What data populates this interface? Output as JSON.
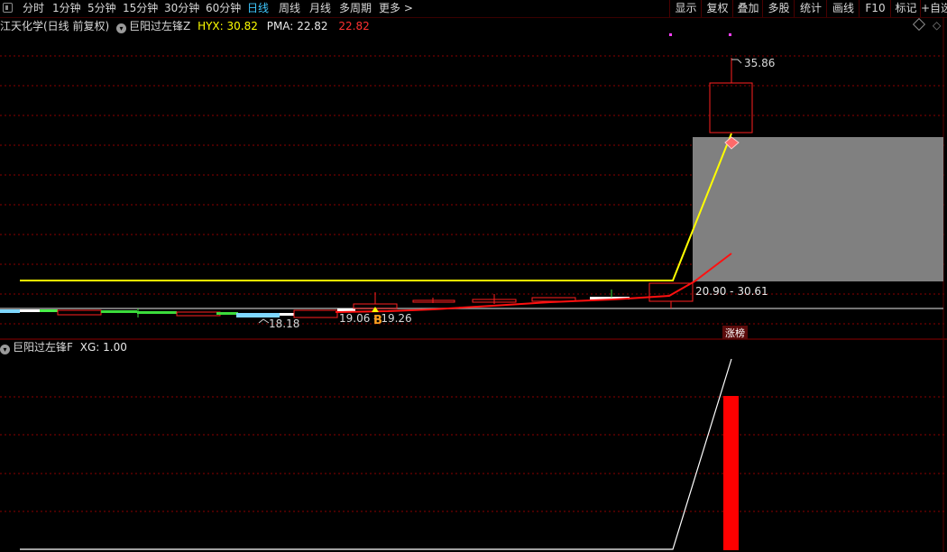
{
  "toolbar": {
    "periods": [
      "分时",
      "1分钟",
      "5分钟",
      "15分钟",
      "30分钟",
      "60分钟",
      "日线",
      "周线",
      "月线",
      "多周期",
      "更多 >"
    ],
    "active_period": "日线",
    "right_buttons": [
      "显示",
      "复权",
      "叠加",
      "多股",
      "统计",
      "画线",
      "F10",
      "标记",
      "+自选"
    ]
  },
  "main_header": {
    "title": "江天化学(日线 前复权)",
    "indicator_name": "巨阳过左锋Z",
    "hyx_label": "HYX:",
    "hyx_value": "30.82",
    "pma_label": "PMA:",
    "pma_value": "22.82",
    "pma_value2": "22.82"
  },
  "chart_labels": {
    "peak": "35.86",
    "low": "18.18",
    "range_buy": "19.06 - 19.26",
    "range_current": "20.90 - 30.61",
    "buy_marker": "B",
    "limit_up_badge": "涨榜"
  },
  "sub_header": {
    "indicator_name": "巨阳过左锋F",
    "xg_label": "XG:",
    "xg_value": "1.00"
  },
  "colors": {
    "background": "#000000",
    "grid": "#8b0000",
    "hyx_line": "#ffff00",
    "pma_line": "#ff0000",
    "box_fill": "#808080",
    "active_tab": "#3ec8ff",
    "signal_bar": "#ff0000"
  }
}
